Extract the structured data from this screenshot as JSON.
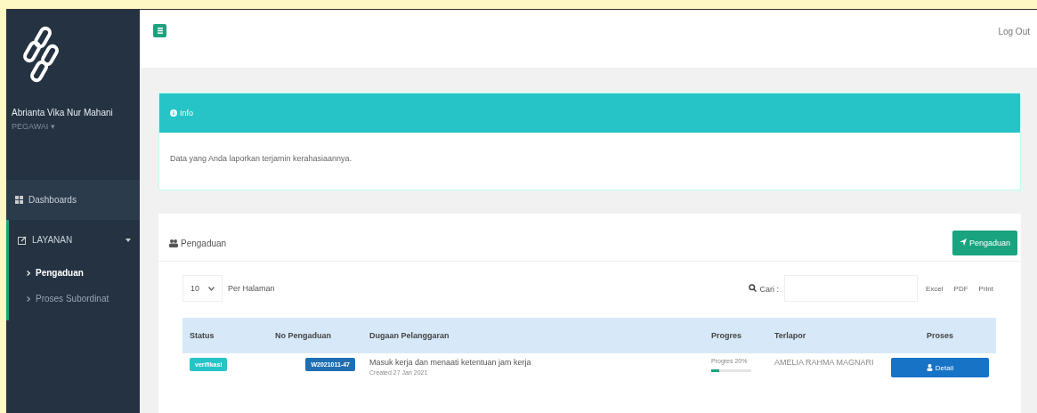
{
  "sidebar": {
    "user_name": "Abrianta Vika Nur Mahani",
    "role": "PEGAWAI ▾",
    "items": [
      {
        "label": "Dashboards"
      },
      {
        "label": "LAYANAN",
        "expanded": true,
        "children": [
          {
            "label": "Pengaduan",
            "selected": true
          },
          {
            "label": "Proses Subordinat",
            "selected": false
          }
        ]
      }
    ]
  },
  "topbar": {
    "logout": "Log Out"
  },
  "info_panel": {
    "title": "Info",
    "message": "Data yang Anda laporkan terjamin kerahasiaannya."
  },
  "complaints_panel": {
    "title": "Pengaduan",
    "add_button": "Pengaduan",
    "page_size": "10",
    "page_size_label": "Per Halaman",
    "search_label": "Cari :",
    "export_buttons": [
      "Excel",
      "PDF",
      "Print"
    ],
    "table": {
      "columns": [
        "Status",
        "No Pengaduan",
        "Dugaan Pelanggaran",
        "Progres",
        "Terlapor",
        "Proses"
      ],
      "rows": [
        {
          "status": "verifikasi",
          "number": "W2021011-47",
          "violation": "Masuk kerja dan menaati ketentuan jam kerja",
          "created": "Created 27 Jan 2021",
          "progress_label": "Progres 20%",
          "level": 0.2,
          "reported": "AMELIA RAHMA MAGNARI",
          "action": "Detail"
        }
      ]
    }
  }
}
